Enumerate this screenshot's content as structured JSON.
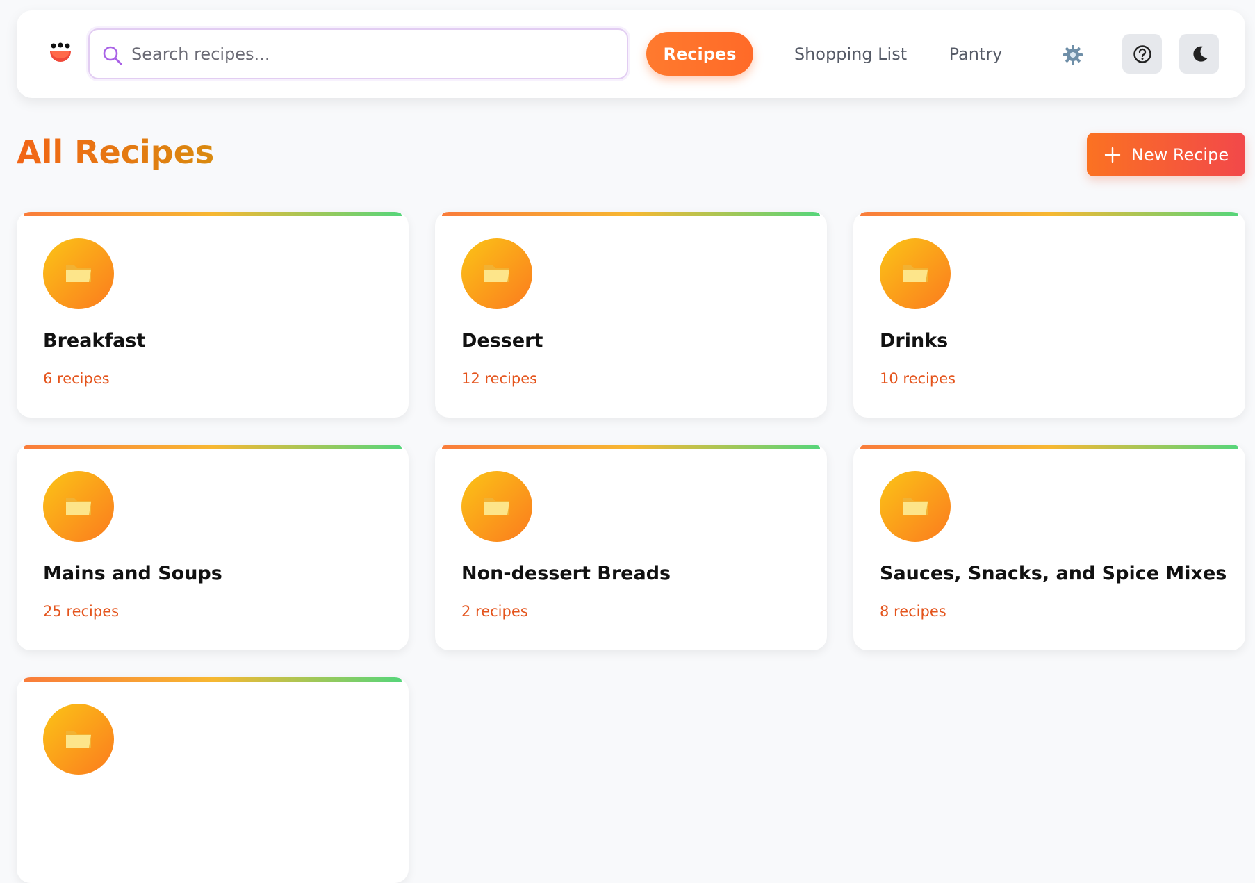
{
  "search": {
    "placeholder": "Search recipes..."
  },
  "nav": {
    "recipes": "Recipes",
    "shopping_list": "Shopping List",
    "pantry": "Pantry"
  },
  "page": {
    "title": "All Recipes",
    "new_recipe_label": "New Recipe"
  },
  "colors": {
    "accent": "#ff7a2e",
    "count_text": "#e4541c",
    "card_bar_start": "#f97c3a",
    "card_bar_end": "#56d57a"
  },
  "categories": [
    {
      "name": "Breakfast",
      "count": "6 recipes",
      "icon": "folder-icon"
    },
    {
      "name": "Dessert",
      "count": "12 recipes",
      "icon": "folder-icon"
    },
    {
      "name": "Drinks",
      "count": "10 recipes",
      "icon": "folder-icon"
    },
    {
      "name": "Mains and Soups",
      "count": "25 recipes",
      "icon": "folder-icon"
    },
    {
      "name": "Non-dessert Breads",
      "count": "2 recipes",
      "icon": "folder-icon"
    },
    {
      "name": "Sauces, Snacks, and Spice Mixes",
      "count": "8 recipes",
      "icon": "folder-icon"
    },
    {
      "name": "",
      "count": "",
      "icon": "folder-icon"
    }
  ]
}
